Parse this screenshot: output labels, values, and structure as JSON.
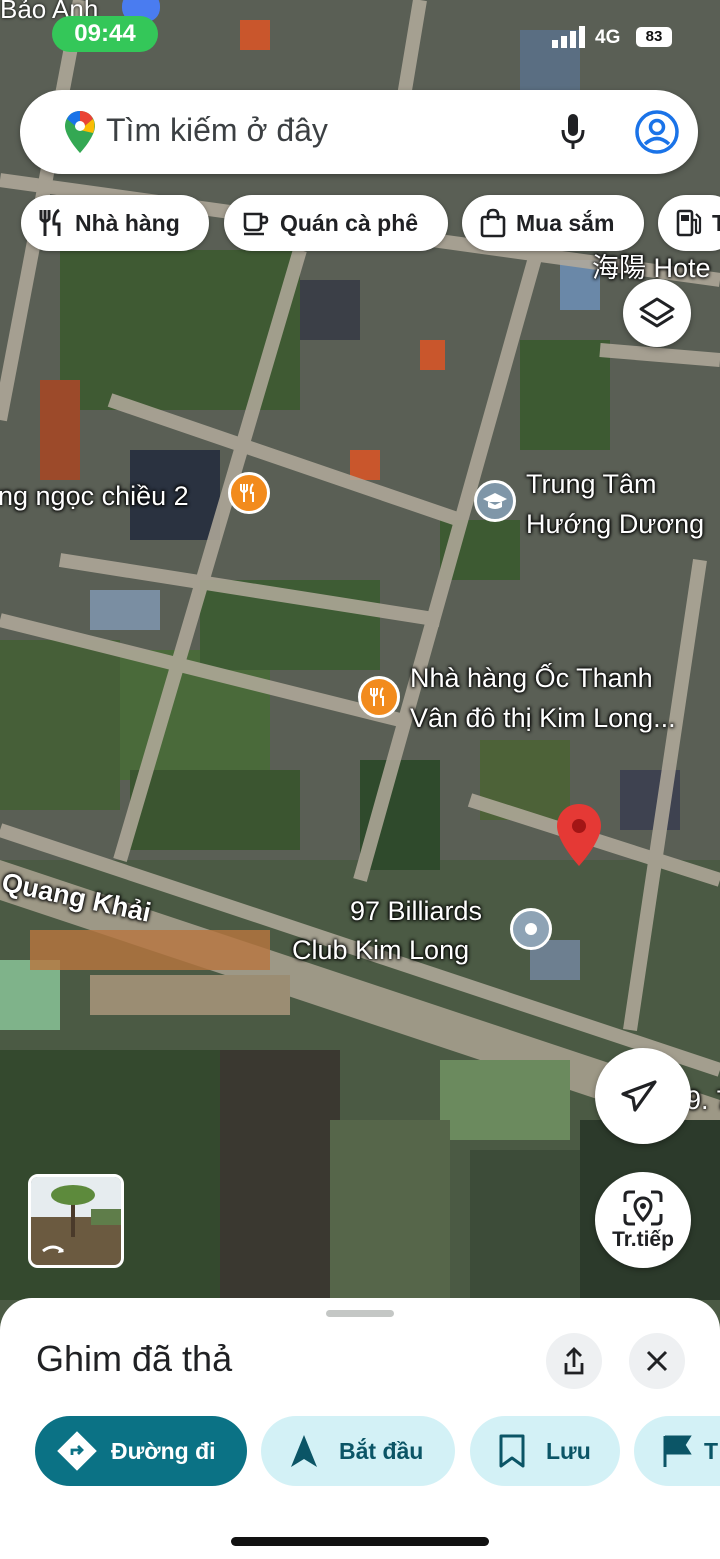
{
  "status_bar": {
    "carrier_label": "Bảo Anh",
    "time": "09:44",
    "network": "4G",
    "battery": "83"
  },
  "search": {
    "placeholder": "Tìm kiếm ở đây"
  },
  "chips": [
    {
      "label": "Nhà hàng",
      "icon": "restaurant-icon"
    },
    {
      "label": "Quán cà phê",
      "icon": "coffee-icon"
    },
    {
      "label": "Mua sắm",
      "icon": "shopping-bag-icon"
    },
    {
      "label": "T",
      "icon": "gas-station-icon"
    }
  ],
  "map": {
    "labels": {
      "hotel": "海陽 Hote",
      "restaurant_left": "ng ngọc chiều 2",
      "school_line1": "Trung Tâm",
      "school_line2": "Hướng Dương",
      "restaurant_center_line1": "Nhà hàng Ốc Thanh",
      "restaurant_center_line2": "Vân đô thị Kim Long...",
      "street": "Quang Khải",
      "billiards_line1": "97 Billiards",
      "billiards_line2": "Club Kim Long",
      "edge_text": "9. 7"
    },
    "colors": {
      "restaurant_poi": "#f28b1d",
      "school_poi": "#7f96a8",
      "generic_poi": "#8ea3b5",
      "dropped_pin": "#e53935"
    }
  },
  "controls": {
    "layers_icon": "layers-icon",
    "locate_icon": "navigation-arrow-icon",
    "live_label": "Tr.tiếp"
  },
  "sheet": {
    "title": "Ghim đã thả",
    "actions": [
      {
        "label": "Đường đi",
        "icon": "directions-icon"
      },
      {
        "label": "Bắt đầu",
        "icon": "navigation-icon"
      },
      {
        "label": "Lưu",
        "icon": "bookmark-icon"
      },
      {
        "label": "T",
        "icon": "flag-icon"
      }
    ]
  }
}
